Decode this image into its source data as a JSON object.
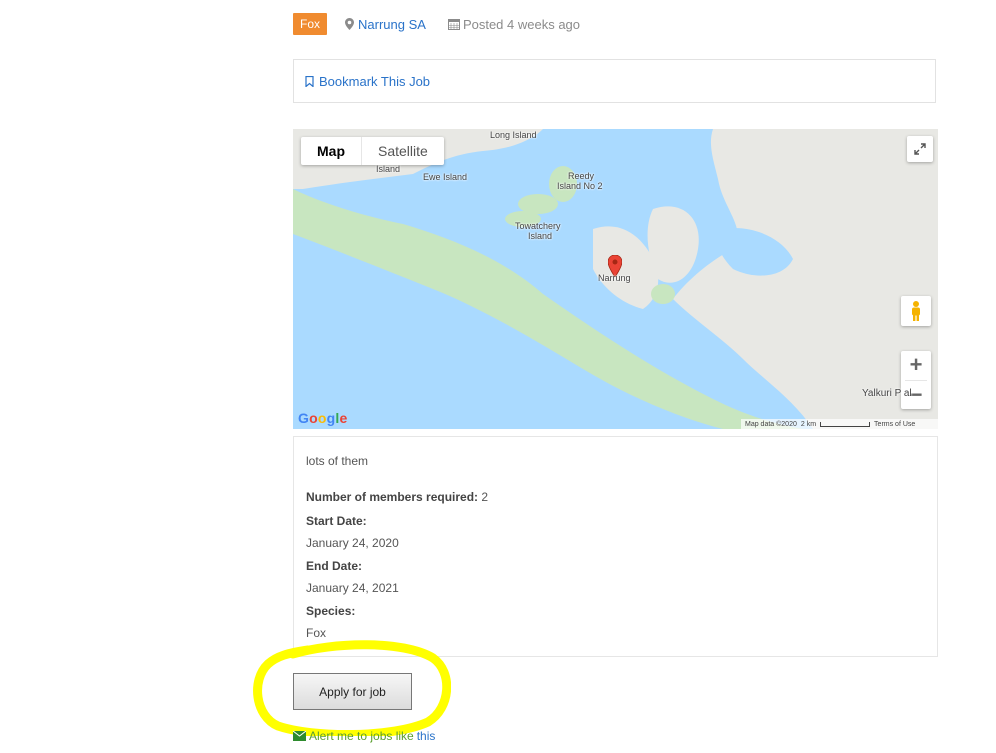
{
  "job": {
    "tag": "Fox",
    "location": "Narrung SA",
    "posted": "Posted 4 weeks ago",
    "tag_color": "#f08b2f",
    "link_color": "#2a73c9"
  },
  "bookmark": {
    "label": "Bookmark This Job",
    "icon": "bookmark-icon"
  },
  "map": {
    "type_map": "Map",
    "type_satellite": "Satellite",
    "labels": {
      "long_island": "Long Island",
      "island": "Island",
      "ewe_island": "Ewe Island",
      "reedy_1": "Reedy",
      "reedy_2": "Island No 2",
      "towatchery_1": "Towatchery",
      "towatchery_2": "Island",
      "narrung": "Narrung",
      "yalkuri": "Yalkuri P   al"
    },
    "google": "Google",
    "map_data": "Map data ©2020",
    "scale": "2 km",
    "terms": "Terms of Use",
    "zoom_in": "+",
    "zoom_out": "−"
  },
  "details": {
    "description": "lots of them",
    "members_label": "Number of members required:",
    "members_value": "2",
    "start_label": "Start Date:",
    "start_value": "January 24, 2020",
    "end_label": "End Date:",
    "end_value": "January 24, 2021",
    "species_label": "Species:",
    "species_value": "Fox"
  },
  "apply": {
    "label": "Apply for job",
    "highlight_color": "#ffff00"
  },
  "alert": {
    "text": "Alert me to jobs like",
    "link": "this",
    "color": "#5a9e2f"
  }
}
